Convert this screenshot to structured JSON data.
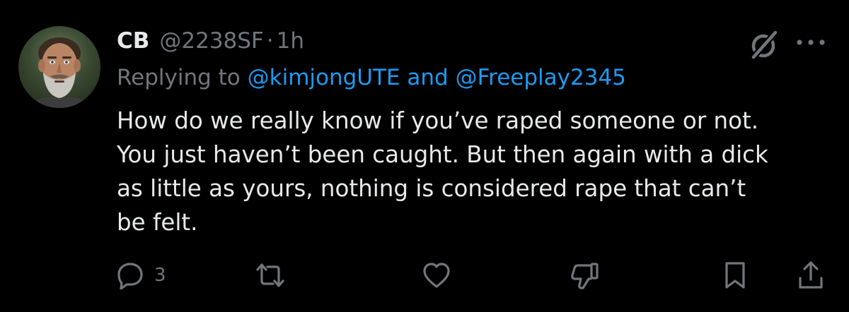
{
  "colors": {
    "background": "#000000",
    "text_primary": "#e7e9ea",
    "text_secondary": "#71767b",
    "mention": "#1d9bf0"
  },
  "post": {
    "author": {
      "display_name": "CB",
      "handle": "@2238SF",
      "separator": "·",
      "time": "1h",
      "avatar_icon": "avatar-illustration"
    },
    "replying": {
      "prefix": "Replying to",
      "mention_1": "@kimjongUTE",
      "conjunction": "and",
      "mention_2": "@Freeplay2345"
    },
    "text_lines": [
      "How do we really know if you’ve raped someone or not.",
      "You just haven’t been caught. But then again with a dick",
      "as little as yours, nothing is considered rape that can’t",
      "be felt."
    ],
    "header_icons": [
      "grok-icon",
      "more-icon"
    ],
    "actions": {
      "reply_count": "3",
      "icons": [
        "reply-icon",
        "repost-icon",
        "like-icon",
        "downvote-icon",
        "bookmark-icon",
        "share-icon"
      ]
    }
  }
}
